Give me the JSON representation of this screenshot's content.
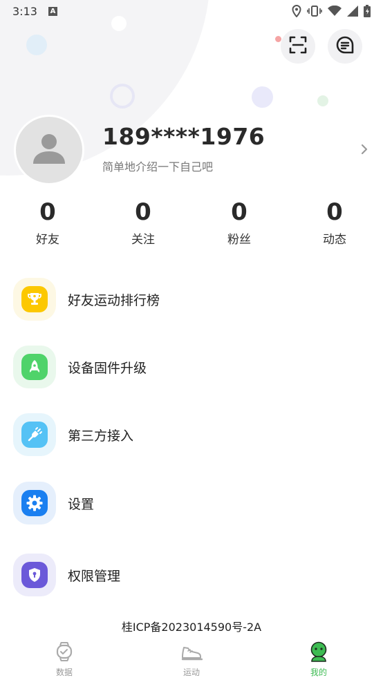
{
  "status_bar": {
    "time": "3:13",
    "notification_badge": "A",
    "icons": [
      "location-icon",
      "vibrate-icon",
      "wifi-icon",
      "signal-icon",
      "battery-icon"
    ]
  },
  "header": {
    "scan_icon": "scan-icon",
    "message_icon": "message-icon"
  },
  "profile": {
    "phone": "189****1976",
    "bio": "简单地介绍一下自己吧",
    "arrow_icon": "chevron-right-icon"
  },
  "stats": [
    {
      "value": "0",
      "label": "好友"
    },
    {
      "value": "0",
      "label": "关注"
    },
    {
      "value": "0",
      "label": "粉丝"
    },
    {
      "value": "0",
      "label": "动态"
    }
  ],
  "menu": [
    {
      "label": "好友运动排行榜",
      "icon": "trophy-icon",
      "color": "#fcc800",
      "bg": "#fdf8e4"
    },
    {
      "label": "设备固件升级",
      "icon": "rocket-icon",
      "color": "#4fd36a",
      "bg": "#e9f8ec"
    },
    {
      "label": "第三方接入",
      "icon": "plug-icon",
      "color": "#55c2f5",
      "bg": "#e6f5fc"
    },
    {
      "label": "设置",
      "icon": "gear-icon",
      "color": "#1a7ff0",
      "bg": "#e5effc"
    },
    {
      "label": "权限管理",
      "icon": "shield-lock-icon",
      "color": "#6b59d9",
      "bg": "#ecebfa"
    }
  ],
  "icp": "桂ICP备2023014590号-2A",
  "bottom_nav": [
    {
      "label": "数据",
      "icon": "watch-icon",
      "active": false
    },
    {
      "label": "运动",
      "icon": "shoe-icon",
      "active": false
    },
    {
      "label": "我的",
      "icon": "person-icon",
      "active": true
    }
  ],
  "colors": {
    "active_nav": "#3dbb52",
    "inactive_nav": "#999999"
  }
}
